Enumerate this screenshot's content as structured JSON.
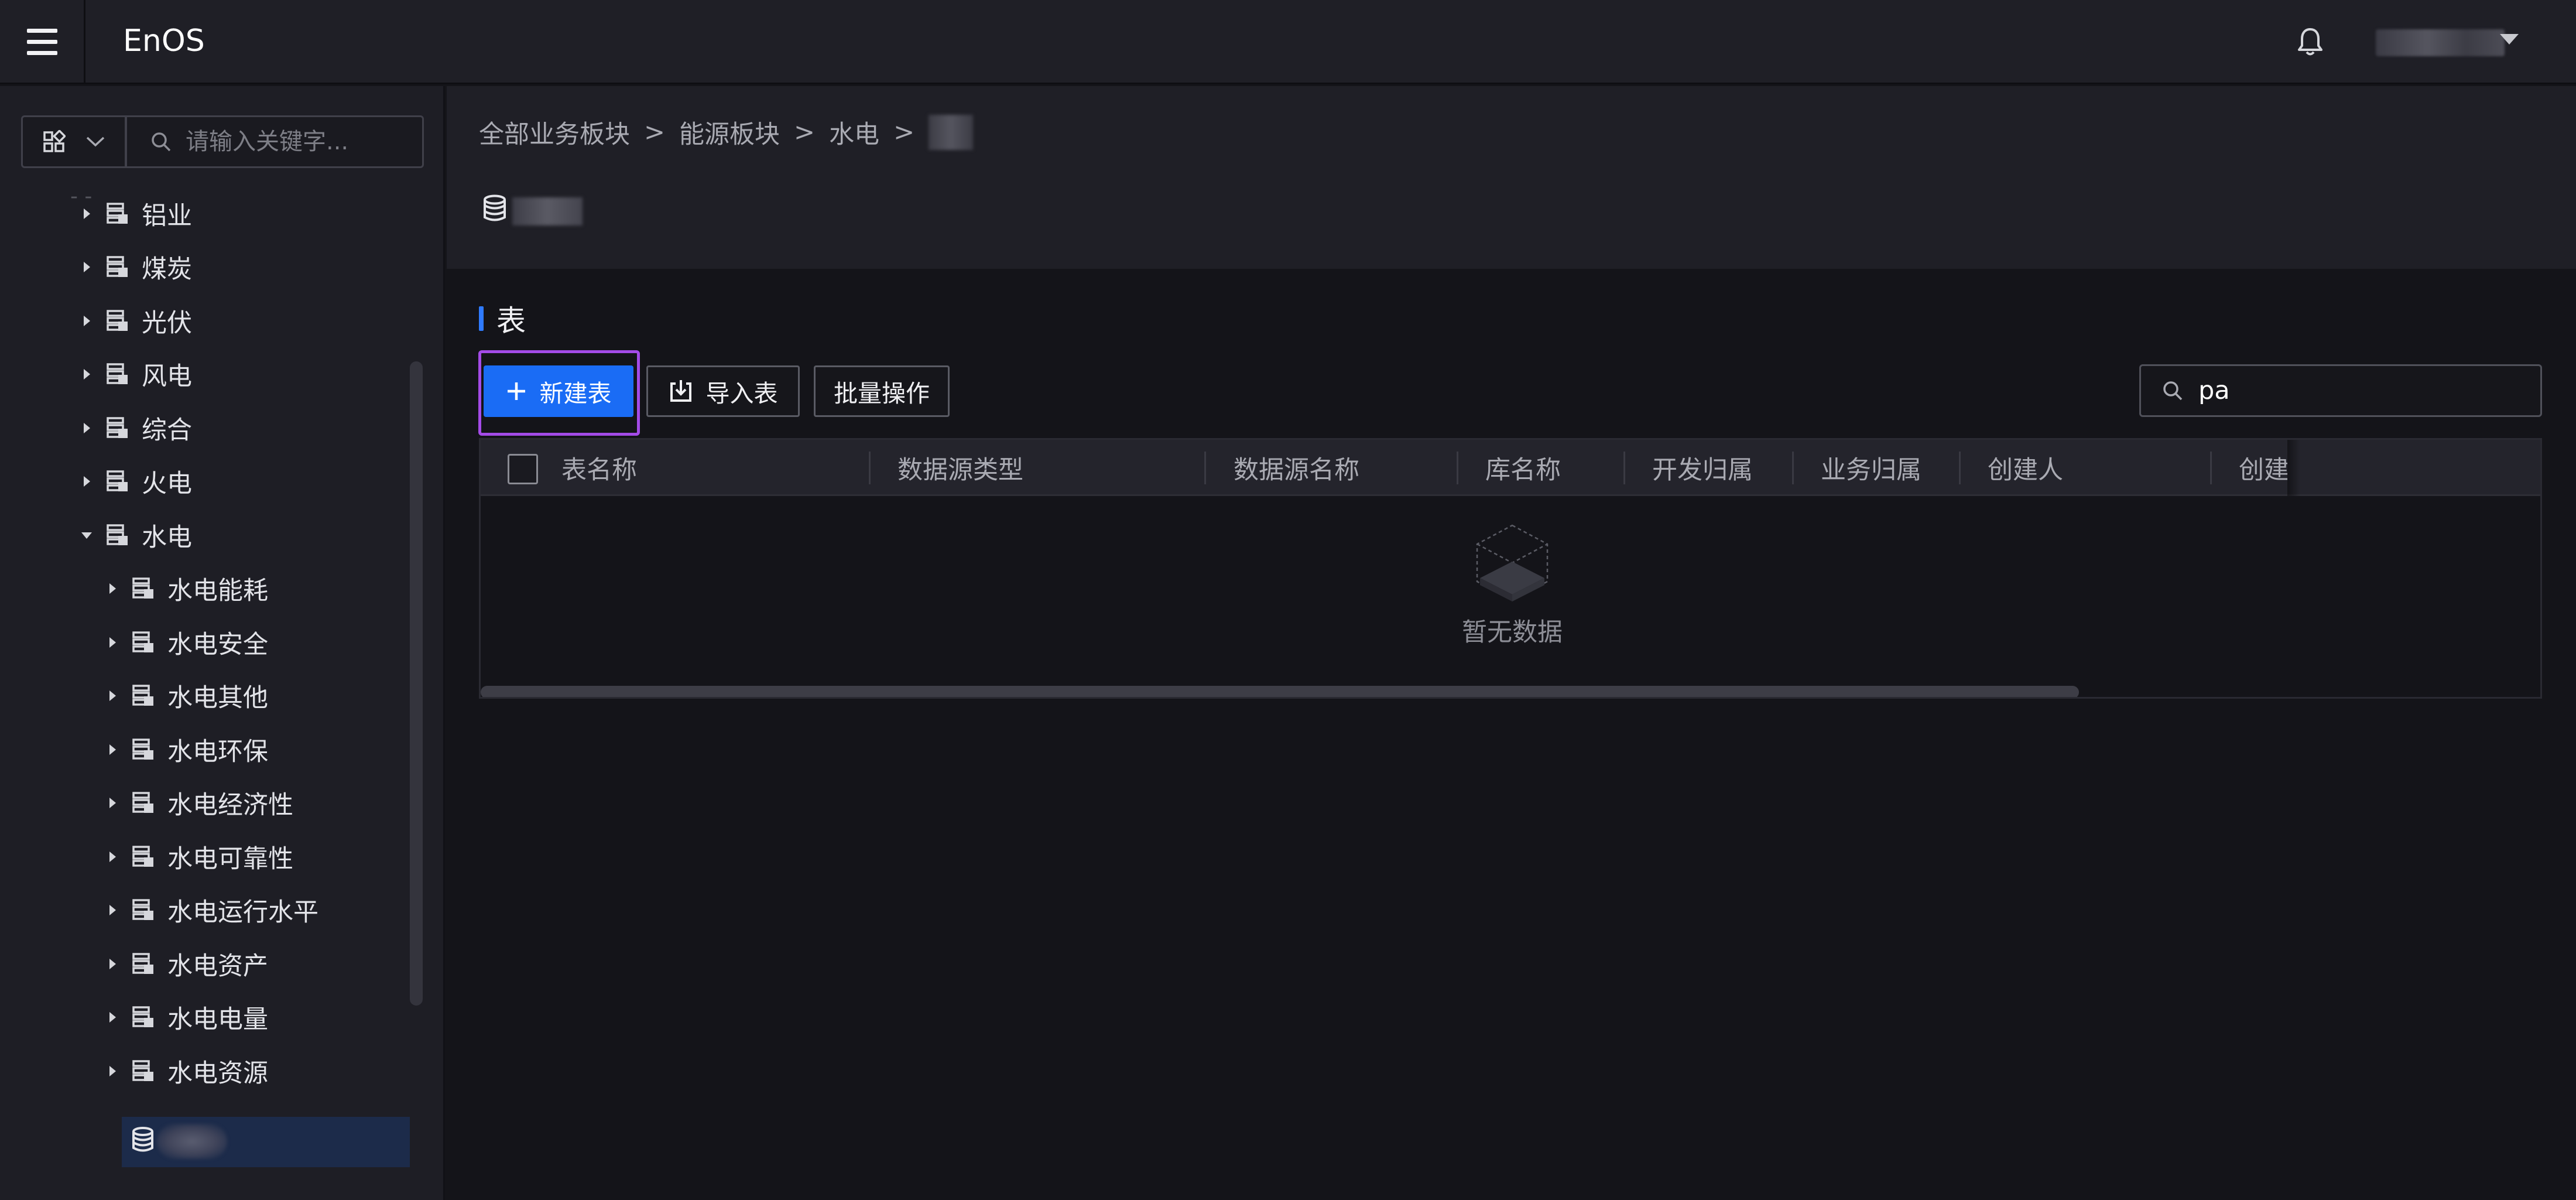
{
  "header": {
    "app_title": "EnOS",
    "icons": [
      "menu-icon",
      "bell-icon",
      "chevron-down-icon"
    ]
  },
  "sidebar": {
    "search_placeholder": "请输入关键字...",
    "tree": [
      {
        "label": "铝业",
        "level": 1,
        "expanded": false
      },
      {
        "label": "煤炭",
        "level": 1,
        "expanded": false
      },
      {
        "label": "光伏",
        "level": 1,
        "expanded": false
      },
      {
        "label": "风电",
        "level": 1,
        "expanded": false
      },
      {
        "label": "综合",
        "level": 1,
        "expanded": false
      },
      {
        "label": "火电",
        "level": 1,
        "expanded": false
      },
      {
        "label": "水电",
        "level": 1,
        "expanded": true
      },
      {
        "label": "水电能耗",
        "level": 2,
        "expanded": false
      },
      {
        "label": "水电安全",
        "level": 2,
        "expanded": false
      },
      {
        "label": "水电其他",
        "level": 2,
        "expanded": false
      },
      {
        "label": "水电环保",
        "level": 2,
        "expanded": false
      },
      {
        "label": "水电经济性",
        "level": 2,
        "expanded": false
      },
      {
        "label": "水电可靠性",
        "level": 2,
        "expanded": false
      },
      {
        "label": "水电运行水平",
        "level": 2,
        "expanded": false
      },
      {
        "label": "水电资产",
        "level": 2,
        "expanded": false
      },
      {
        "label": "水电电量",
        "level": 2,
        "expanded": false
      },
      {
        "label": "水电资源",
        "level": 2,
        "expanded": false
      }
    ]
  },
  "breadcrumb": [
    "全部业务板块",
    "能源板块",
    "水电"
  ],
  "section": {
    "title": "表"
  },
  "toolbar": {
    "new_table": "新建表",
    "import_table": "导入表",
    "batch_ops": "批量操作",
    "search_value": "pa"
  },
  "table": {
    "columns": [
      "表名称",
      "数据源类型",
      "数据源名称",
      "库名称",
      "开发归属",
      "业务归属",
      "创建人",
      "创建"
    ],
    "empty_text": "暂无数据"
  }
}
